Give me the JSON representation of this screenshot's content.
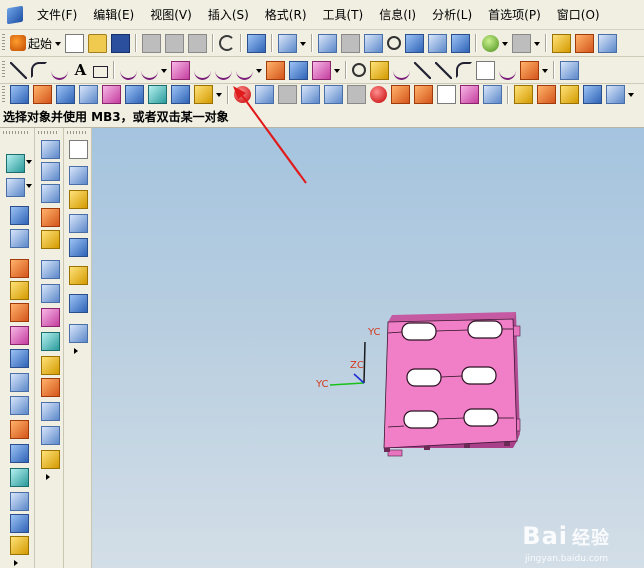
{
  "menubar": {
    "items": [
      "文件(F)",
      "编辑(E)",
      "视图(V)",
      "插入(S)",
      "格式(R)",
      "工具(T)",
      "信息(I)",
      "分析(L)",
      "首选项(P)",
      "窗口(O)"
    ]
  },
  "toolbar": {
    "start_label": "起始"
  },
  "prompt": {
    "text": "选择对象并使用 MB3，或者双击某一对象"
  },
  "viewport": {
    "axis_labels": {
      "yc_top": "YC",
      "zc": "ZC",
      "yc_left": "YC"
    },
    "part_color": "#f07fc8",
    "background_top": "#a5c4df",
    "background_bottom": "#d3dee7"
  },
  "annotation": {
    "arrow_color": "#e01b1b"
  },
  "watermark": {
    "brand": "Bai",
    "brand_cn": "经验",
    "url": "jingyan.baidu.com"
  },
  "icons": {
    "app": "nx-app-icon",
    "highlighted": "red-sphere-icon"
  }
}
